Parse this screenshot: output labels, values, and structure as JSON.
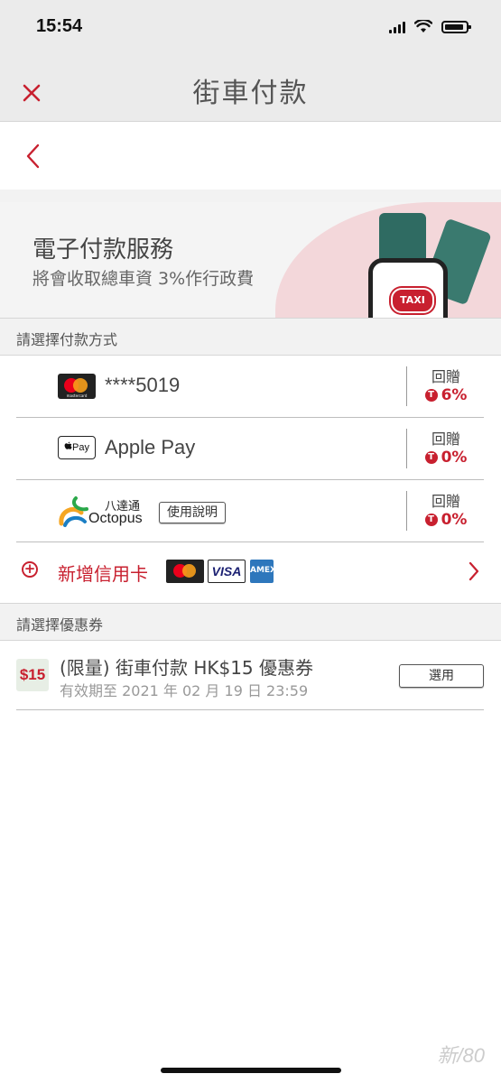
{
  "status_bar": {
    "time": "15:54"
  },
  "nav": {
    "title": "街車付款"
  },
  "banner": {
    "title": "電子付款服務",
    "subtitle": "將會收取總車資 3%作行政費",
    "taxi_label": "TAXI"
  },
  "payment_section": {
    "header": "請選擇付款方式",
    "methods": [
      {
        "label": "****5019",
        "logo": "mastercard-icon",
        "rebate_label": "回贈",
        "rebate": "6%"
      },
      {
        "label": "Apple Pay",
        "logo": "apple-pay-icon",
        "logo_text": "Pay",
        "rebate_label": "回贈",
        "rebate": "0%"
      },
      {
        "label": "",
        "logo": "octopus-icon",
        "logo_cn": "八達通",
        "logo_en": "Octopus",
        "extra_button": "使用說明",
        "rebate_label": "回贈",
        "rebate": "0%"
      }
    ],
    "add_card": {
      "label": "新增信用卡",
      "visa": "VISA",
      "amex": "AMEX"
    }
  },
  "voucher_section": {
    "header": "請選擇優惠券",
    "voucher": {
      "badge": "$15",
      "title": "(限量) 街車付款 HK$15 優惠券",
      "validity": "有效期至 2021 年 02 月 19 日 23:59",
      "button": "選用"
    }
  },
  "watermark": "新/80",
  "colors": {
    "accent": "#c8202f",
    "header_bg": "#ebebeb",
    "section_bg": "#f2f2f2"
  }
}
